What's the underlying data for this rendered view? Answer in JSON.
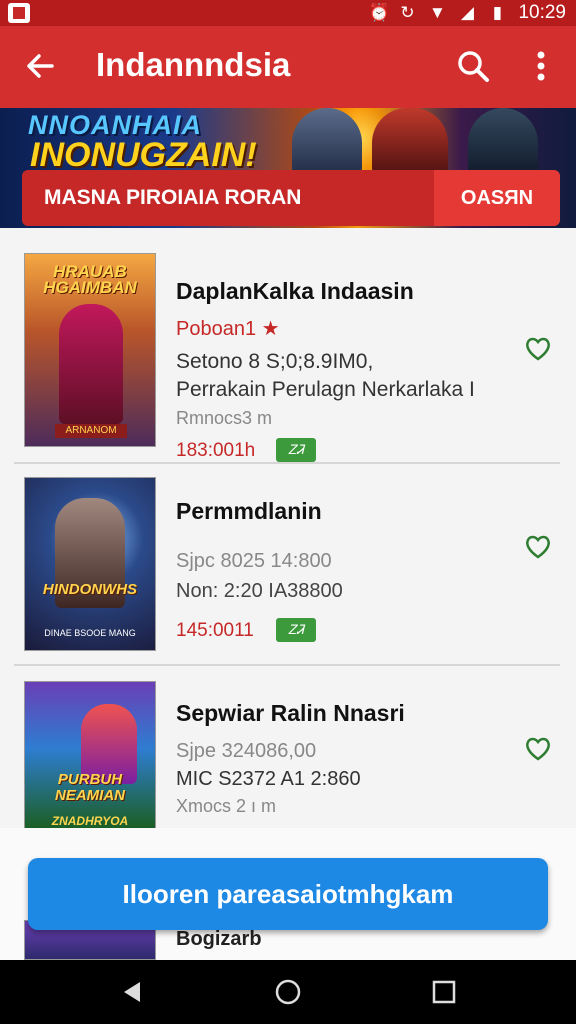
{
  "status": {
    "time": "10:29"
  },
  "toolbar": {
    "title": "Indannndsia"
  },
  "banner": {
    "headline1": "NNOANHAIA",
    "headline2": "INONUGZAIN!",
    "bar_label": "MASNA PIROIAIA RORAN",
    "tab_label": "OASЯN"
  },
  "items": [
    {
      "name": "DaplanKalka Indaasin",
      "meta1": "Poboan1 ★",
      "meta2": "Setono 8 S;0;8.9IM0,",
      "meta3": "Perrakain Perulagn Nerkarlaka I",
      "meta4": "Rmnocs3       m",
      "price": "183:001h",
      "badge": "ᏃᏘ",
      "cover_title": "HRAUAB HGAIMBAN",
      "cover_label": "ARNANOM"
    },
    {
      "name": "Permmdlanin",
      "meta2": "Sjpc 8025 14:800",
      "meta3": "Non: 2:20 IA38800",
      "price": "145:0011",
      "badge": "ᏃᏘ",
      "cover_title": "HINDONWHS",
      "cover_label": "DINAE BSOOE MANG"
    },
    {
      "name": "Sepwiar Ralin Nnasri",
      "meta2": "Sjpe 324086,00",
      "meta3": "MIC S2372 A1 2:860",
      "meta4": "Xmocs 2    ı m",
      "cover_title": "PURBUH NEAMIAN",
      "cover_label": "ZNADHRYOA"
    }
  ],
  "float_button": {
    "label": "Ilooren pareasaiotmhgkam"
  },
  "peek": {
    "text": "Bogizarb"
  },
  "colors": {
    "primary": "#d32f2f",
    "accent": "#1e88e5",
    "badge": "#3c9a3c"
  }
}
